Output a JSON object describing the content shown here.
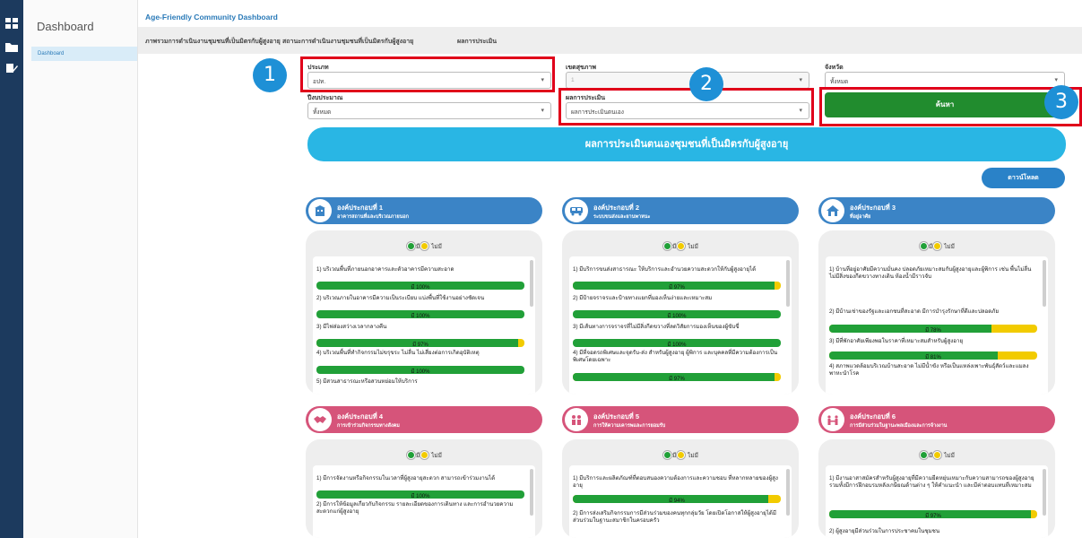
{
  "app": {
    "nav_title": "Dashboard",
    "nav_item": "Dashboard",
    "breadcrumb": "Age-Friendly Community Dashboard"
  },
  "tabs": [
    "ภาพรวมการดำเนินงานชุมชนที่เป็นมิตรกับผู้สูงอายุ",
    "สถานะการดำเนินงานชุมชนที่เป็นมิตรกับผู้สูงอายุ",
    "ผลการประเมิน"
  ],
  "filters": {
    "type_label": "ประเภท",
    "type_value": "อปท.",
    "zone_label": "เขตสุขภาพ",
    "zone_value": "1",
    "province_label": "จังหวัด",
    "province_value": "ทั้งหมด",
    "budget_label": "ปีงบประมาณ",
    "budget_value": "ทั้งหมด",
    "result_label": "ผลการประเมิน",
    "result_value": "ผลการประเมินตนเอง",
    "search_label": "ค้นหา"
  },
  "annotations": [
    "1",
    "2",
    "3"
  ],
  "banner_title": "ผลการประเมินตนเองชุมชนที่เป็นมิตรกับผู้สูงอายุ",
  "download_label": "ดาวน์โหลด",
  "legend": {
    "yes": "มี",
    "no": "ไม่มี"
  },
  "colors": {
    "green": "#21a038",
    "yellow": "#f2cb00",
    "blue_header": "#3b84c6",
    "pink_header": "#d6547a"
  },
  "cards": [
    {
      "title": "องค์ประกอบที่ 1",
      "subtitle": "อาคารสถานที่และบริเวณภายนอก",
      "icon": "building-outdoor-icon",
      "items": [
        {
          "text": "1) บริเวณพื้นที่ภายนอกอาคารและตัวอาคารมีความสะอาด",
          "pct_label": "มี 100%",
          "pct": 100
        },
        {
          "text": "2) บริเวณภายในอาคารมีความเป็นระเบียบ แบ่งพื้นที่ใช้งานอย่างชัดเจน",
          "pct_label": "มี 100%",
          "pct": 100
        },
        {
          "text": "3) มีไฟส่องสว่างเวลากลางคืน",
          "pct_label": "มี 97%",
          "pct": 97
        },
        {
          "text": "4) บริเวณพื้นที่ทำกิจกรรมไม่ขรุขระ ไม่ลื่น ไม่เสี่ยงต่อการเกิดอุบัติเหตุ",
          "pct_label": "มี 100%",
          "pct": 100
        },
        {
          "text": "5) มีสวนสาธารณะหรือสวนหย่อมให้บริการ",
          "pct_label": "",
          "pct": 100
        }
      ]
    },
    {
      "title": "องค์ประกอบที่ 2",
      "subtitle": "ระบบขนส่งและยานพาหนะ",
      "icon": "bus-icon",
      "items": [
        {
          "text": "1) มีบริการขนส่งสาธารณะ ให้บริการและอำนวยความสะดวกให้กับผู้สูงอายุได้",
          "pct_label": "มี 97%",
          "pct": 97
        },
        {
          "text": "2) มีป้ายจราจรและป้ายทางแยกที่มองเห็นง่ายและเหมาะสม",
          "pct_label": "มี 100%",
          "pct": 100
        },
        {
          "text": "3) มีเส้นทางการจราจรที่ไม่มีสิ่งกีดขวางที่ลดวิสัยการมองเห็นของผู้ขับขี่",
          "pct_label": "มี 100%",
          "pct": 100
        },
        {
          "text": "4) มีที่จอดรถพิเศษและจุดรับ-ส่ง สำหรับผู้สูงอายุ ผู้พิการ และบุคคลที่มีความต้องการเป็นพิเศษโดยเฉพาะ",
          "pct_label": "มี 97%",
          "pct": 97
        }
      ]
    },
    {
      "title": "องค์ประกอบที่ 3",
      "subtitle": "ที่อยู่อาศัย",
      "icon": "house-icon",
      "items": [
        {
          "text": "1) บ้านที่อยู่อาศัยมีความมั่นคง ปลอดภัยเหมาะสมกับผู้สูงอายุและผู้พิการ เช่น พื้นไม่ลื่น ไม่มีสิ่งของกีดขวางทางเดิน ห้องน้ำมีราวจับ",
          "pct_label": "",
          "pct": 100
        },
        {
          "text": "2) มีบ้านเช่าของรัฐและเอกชนที่สะอาด มีการบำรุงรักษาที่ดีและปลอดภัย",
          "pct_label": "มี 78%",
          "pct": 78
        },
        {
          "text": "3) มีที่พักอาศัยเพียงพอในราคาที่เหมาะสมสำหรับผู้สูงอายุ",
          "pct_label": "มี 81%",
          "pct": 81
        },
        {
          "text": "4) สภาพแวดล้อมบริเวณบ้านสะอาด ไม่มีน้ำขัง หรือเป็นแหล่งเพาะพันธุ์สัตว์และแมลงพาหะนำโรค",
          "pct_label": "",
          "pct": 100
        }
      ]
    },
    {
      "title": "องค์ประกอบที่ 4",
      "subtitle": "การเข้าร่วมกิจกรรมทางสังคม",
      "icon": "handshake-icon",
      "items": [
        {
          "text": "1) มีการจัดงานหรือกิจกรรมในเวลาที่ผู้สูงอายุสะดวก สามารถเข้าร่วมงานได้",
          "pct_label": "มี 100%",
          "pct": 100
        },
        {
          "text": "2) มีการให้ข้อมูลเกี่ยวกับกิจกรรม รายละเอียดของการเดินทาง และการอำนวยความสะดวกแก่ผู้สูงอายุ",
          "pct_label": "",
          "pct": 100
        }
      ]
    },
    {
      "title": "องค์ประกอบที่ 5",
      "subtitle": "การให้ความเคารพและการยอมรับ",
      "icon": "people-icon",
      "items": [
        {
          "text": "1) มีบริการและผลิตภัณฑ์ที่ตอบสนองความต้องการและความชอบ ที่หลากหลายของผู้สูงอายุ",
          "pct_label": "มี 94%",
          "pct": 94
        },
        {
          "text": "2) มีการส่งเสริมกิจกรรมการมีส่วนร่วมของคนทุกกลุ่มวัย โดยเปิดโอกาสให้ผู้สูงอายุได้มีส่วนร่วมในฐานะสมาชิกในครอบครัว",
          "pct_label": "",
          "pct": 100
        }
      ]
    },
    {
      "title": "องค์ประกอบที่ 6",
      "subtitle": "การมีส่วนร่วมในฐานะพลเมืองและการจ้างงาน",
      "icon": "community-icon",
      "items": [
        {
          "text": "1) มีงานอาสาสมัครสำหรับผู้สูงอายุที่มีความยืดหยุ่นเหมาะกับความสามารถของผู้สูงอายุ รวมทั้งมีการฝึกอบรมหลังเกษียณด้านต่าง ๆ ให้คำแนะนำ และมีค่าตอบแทนที่เหมาะสม",
          "pct_label": "มี 97%",
          "pct": 97
        },
        {
          "text": "2) ผู้สูงอายุมีส่วนร่วมในการประชาคมในชุมชน",
          "pct_label": "",
          "pct": 100
        }
      ]
    }
  ]
}
